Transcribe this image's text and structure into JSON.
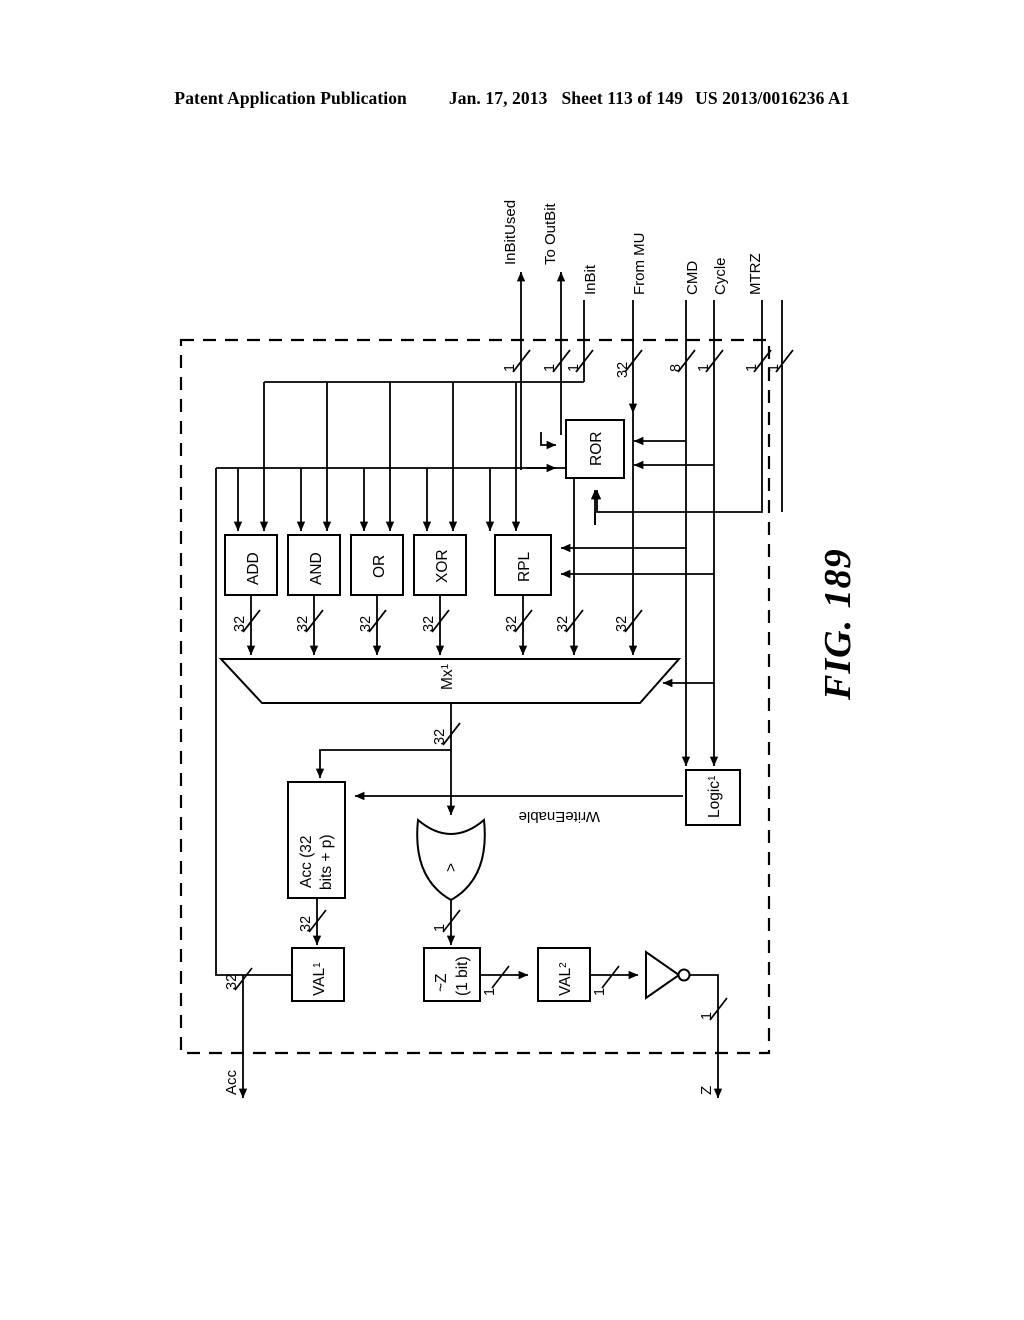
{
  "header": {
    "publication": "Patent Application Publication",
    "date": "Jan. 17, 2013",
    "sheet": "Sheet 113 of 149",
    "number": "US 2013/0016236 A1"
  },
  "figure": {
    "label": "FIG. 189",
    "boundary": "dashed-module-boundary"
  },
  "ports": {
    "top": [
      {
        "name": "InBitUsed",
        "width": "1",
        "direction": "out"
      },
      {
        "name": "To OutBit",
        "width": "1",
        "direction": "out"
      },
      {
        "name": "InBit",
        "width": "1",
        "direction": "in"
      },
      {
        "name": "From MU",
        "width": "32",
        "direction": "in"
      },
      {
        "name": "CMD",
        "width": "8",
        "direction": "in"
      },
      {
        "name": "Cycle",
        "width": "1",
        "direction": "in"
      },
      {
        "name": "MTRZ",
        "width": "1",
        "direction": "in"
      }
    ],
    "bottom": [
      {
        "name": "Acc",
        "width": "32",
        "direction": "out"
      },
      {
        "name": "Z",
        "width": "1",
        "direction": "out"
      }
    ]
  },
  "blocks": {
    "ops": [
      {
        "id": "add",
        "label": "ADD",
        "out_width": "32"
      },
      {
        "id": "and",
        "label": "AND",
        "out_width": "32"
      },
      {
        "id": "or",
        "label": "OR",
        "out_width": "32"
      },
      {
        "id": "xor",
        "label": "XOR",
        "out_width": "32"
      },
      {
        "id": "rpl",
        "label": "RPL",
        "out_width": "32"
      }
    ],
    "ror": {
      "label": "ROR",
      "out_width": "32"
    },
    "bypass_width": "32",
    "mux": {
      "label": "Mx",
      "subscript": "1",
      "out_width": "32"
    },
    "acc": {
      "label_line1": "Acc (32",
      "label_line2": "bits + p)",
      "out_width": "32"
    },
    "orgate": {
      "label": ">",
      "out_width": "1"
    },
    "val1": {
      "label": "VAL",
      "subscript": "1",
      "out_width": "32"
    },
    "notz": {
      "label_line1": "~Z",
      "label_line2": "(1 bit)",
      "out_width": "1"
    },
    "val2": {
      "label": "VAL",
      "subscript": "2",
      "out_width": "1"
    },
    "inverter": {
      "label": "inverter",
      "out_width": "1"
    },
    "logic": {
      "label": "Logic",
      "subscript": "1"
    }
  },
  "signals": {
    "write_enable": "WriteEnable"
  },
  "colors": {
    "line": "#000000",
    "background": "#ffffff"
  }
}
